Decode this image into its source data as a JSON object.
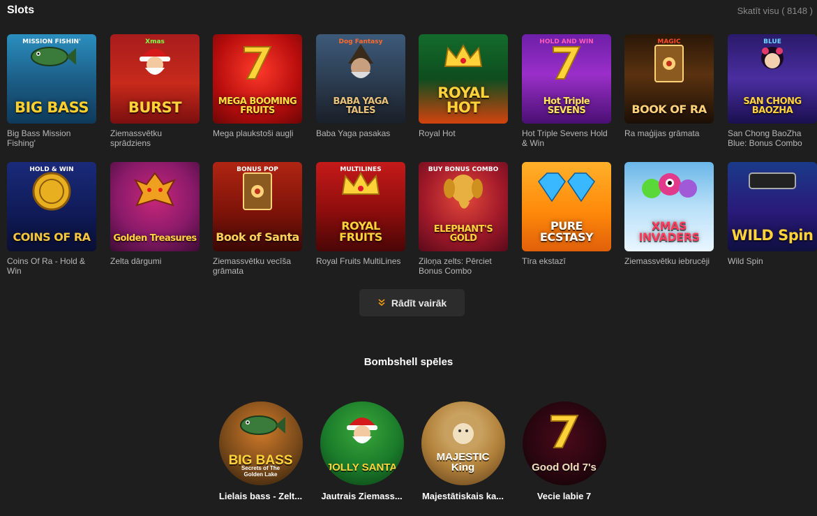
{
  "header": {
    "title": "Slots",
    "see_all": "Skatīt visu ( 8148 )"
  },
  "games": [
    {
      "name": "Big Bass Mission Fishing'",
      "logo": "BIG BASS",
      "sub": "MISSION FISHIN'",
      "bg": "linear-gradient(180deg,#2b8fbf 0%,#1c5f88 50%,#0f3a5a 100%)",
      "logo_color": "#ffcf2e",
      "sub_color": "#ffffff",
      "icon": "fish-icon"
    },
    {
      "name": "Ziemassvētku sprādziens",
      "logo": "BURST",
      "sub": "Xmas",
      "bg": "linear-gradient(180deg,#a81c1c 0%,#c72a1b 55%,#7b0f0f 100%)",
      "logo_color": "#ffd23a",
      "sub_color": "#7bff4a",
      "icon": "santa-icon"
    },
    {
      "name": "Mega plaukstoši augļi",
      "logo": "MEGA BOOMING FRUITS",
      "sub": "",
      "bg": "radial-gradient(circle at 50% 40%,#ff3a2a 0%,#b70d0d 60%,#6d0606 100%)",
      "logo_color": "#ffe040",
      "sub_color": "#ffffff",
      "icon": "seven-icon"
    },
    {
      "name": "Baba Yaga pasakas",
      "logo": "BABA YAGA TALES",
      "sub": "Dog Fantasy",
      "bg": "linear-gradient(180deg,#3d5a7a 0%,#2c3e52 50%,#1a1f28 100%)",
      "logo_color": "#e8c27a",
      "sub_color": "#ff6a2a",
      "icon": "witch-icon"
    },
    {
      "name": "Royal Hot",
      "logo": "ROYAL HOT",
      "sub": "",
      "bg": "linear-gradient(180deg,#146b2b 0%,#0e4d1f 50%,#d3430e 100%)",
      "logo_color": "#ffd23a",
      "sub_color": "#ffffff",
      "icon": "crown-icon"
    },
    {
      "name": "Hot Triple Sevens Hold & Win",
      "logo": "Hot Triple SEVENS",
      "sub": "HOLD AND WIN",
      "bg": "linear-gradient(180deg,#6d1fa8 0%,#9a2fc9 45%,#4a0f72 100%)",
      "logo_color": "#ffe35a",
      "sub_color": "#ff5ab8",
      "icon": "seven-icon"
    },
    {
      "name": "Ra maģijas grāmata",
      "logo": "BOOK OF RA",
      "sub": "MAGIC",
      "bg": "linear-gradient(180deg,#2a1708 0%,#5a3210 45%,#1c0f05 100%)",
      "logo_color": "#ffd27a",
      "sub_color": "#ff4a2a",
      "icon": "book-icon"
    },
    {
      "name": "San Chong BaoZha Blue: Bonus Combo",
      "logo": "SAN CHONG BAOZHA",
      "sub": "BLUE",
      "bg": "linear-gradient(180deg,#2a1a6a 0%,#4a2ea0 50%,#1a1050 100%)",
      "logo_color": "#ffd23a",
      "sub_color": "#6ad6ff",
      "icon": "lady-icon"
    },
    {
      "name": "Coins Of Ra - Hold & Win",
      "logo": "COINS OF RA",
      "sub": "HOLD & WIN",
      "bg": "linear-gradient(180deg,#1a2a7a 0%,#0f1a55 60%,#0a0f33 100%)",
      "logo_color": "#f7c640",
      "sub_color": "#ffffff",
      "icon": "coin-icon"
    },
    {
      "name": "Zelta dārgumi",
      "logo": "Golden Treasures",
      "sub": "",
      "bg": "radial-gradient(circle at 50% 40%,#c9277a 0%,#8a1a6a 55%,#3d0c35 100%)",
      "logo_color": "#ffd23a",
      "sub_color": "#ffffff",
      "icon": "dragon-icon"
    },
    {
      "name": "Ziemassvētku vecīša grāmata",
      "logo": "Book of Santa",
      "sub": "BONUS POP",
      "bg": "linear-gradient(180deg,#b02512 0%,#7a1208 60%,#3a0804 100%)",
      "logo_color": "#ffcf5a",
      "sub_color": "#ffffff",
      "icon": "book-icon"
    },
    {
      "name": "Royal Fruits MultiLines",
      "logo": "ROYAL FRUITS",
      "sub": "MULTILINES",
      "bg": "linear-gradient(180deg,#c51a1a 0%,#8e0d0d 55%,#4a0606 100%)",
      "logo_color": "#ffd23a",
      "sub_color": "#ffffff",
      "icon": "crown-icon"
    },
    {
      "name": "Ziloņa zelts: Pērciet Bonus Combo",
      "logo": "ELEPHANT'S GOLD",
      "sub": "BUY BONUS COMBO",
      "bg": "radial-gradient(circle at 50% 40%,#e24a3a 0%,#a31a2a 55%,#5a0a1a 100%)",
      "logo_color": "#ffd23a",
      "sub_color": "#ffffff",
      "icon": "elephant-icon"
    },
    {
      "name": "Tīra ekstazī",
      "logo": "PURE ECSTASY",
      "sub": "",
      "bg": "linear-gradient(180deg,#ffb02a 0%,#ff8a0a 55%,#e0600a 100%)",
      "logo_color": "#ffffff",
      "sub_color": "#ffffff",
      "icon": "diamond-icon"
    },
    {
      "name": "Ziemassvētku iebrucēji",
      "logo": "XMAS INVADERS",
      "sub": "",
      "bg": "linear-gradient(180deg,#6ab6e8 0%,#b8e0f8 50%,#eaf6ff 100%)",
      "logo_color": "#ff3a5a",
      "sub_color": "#ffffff",
      "icon": "alien-icon"
    },
    {
      "name": "Wild Spin",
      "logo": "WILD Spin",
      "sub": "",
      "bg": "linear-gradient(180deg,#1a3a8a 0%,#2a1a7a 55%,#0f0f40 100%)",
      "logo_color": "#ffd23a",
      "sub_color": "#ff5ad8",
      "icon": "bar-icon"
    }
  ],
  "show_more": {
    "label": "Rādīt vairāk"
  },
  "bombshell": {
    "title": "Bombshell spēles",
    "games": [
      {
        "name": "Lielais bass - Zelt...",
        "logo": "BIG BASS",
        "sub": "Secrets of The Golden Lake",
        "bg": "radial-gradient(circle at 50% 35%,#d07a2a 0%,#7a4a1a 55%,#2a1a0a 100%)",
        "logo_color": "#ffd23a",
        "sub_color": "#ffffff",
        "icon": "fish-icon"
      },
      {
        "name": "Jautrais Ziemass...",
        "logo": "JOLLY SANTA",
        "sub": "",
        "bg": "radial-gradient(circle at 50% 35%,#3aa83a 0%,#1a7a2a 55%,#0a3a12 100%)",
        "logo_color": "#ffd23a",
        "sub_color": "#ffffff",
        "icon": "santa-icon"
      },
      {
        "name": "Majestātiskais ka...",
        "logo": "MAJESTIC King",
        "sub": "",
        "bg": "radial-gradient(circle at 50% 35%,#e0c080 0%,#b0803a 55%,#5a3a1a 100%)",
        "logo_color": "#ffffff",
        "sub_color": "#ffd23a",
        "icon": "lion-icon"
      },
      {
        "name": "Vecie labie 7",
        "logo": "Good Old 7's",
        "sub": "",
        "bg": "radial-gradient(circle at 50% 45%,#4a0a1a 0%,#2a0610 55%,#0a0205 100%)",
        "logo_color": "#f0e0c0",
        "sub_color": "#ff3a3a",
        "icon": "seven-icon"
      }
    ]
  }
}
